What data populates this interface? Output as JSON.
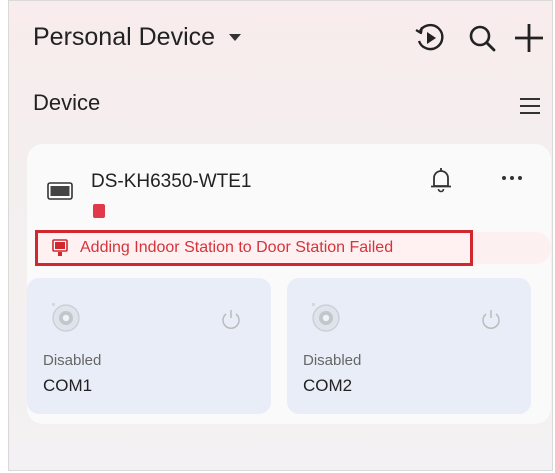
{
  "header": {
    "title": "Personal Device",
    "icons": [
      "playback-icon",
      "search-icon",
      "add-icon"
    ]
  },
  "section": {
    "title": "Device",
    "menu_icon": "menu-icon"
  },
  "device": {
    "name": "DS-KH6350-WTE1",
    "error": "Adding Indoor Station to Door Station Failed",
    "channels": [
      {
        "status": "Disabled",
        "name": "COM1"
      },
      {
        "status": "Disabled",
        "name": "COM2"
      }
    ]
  },
  "colors": {
    "error": "#d0282e",
    "channel_bg": "#e8edf8",
    "sd_badge": "#e03a4a"
  }
}
